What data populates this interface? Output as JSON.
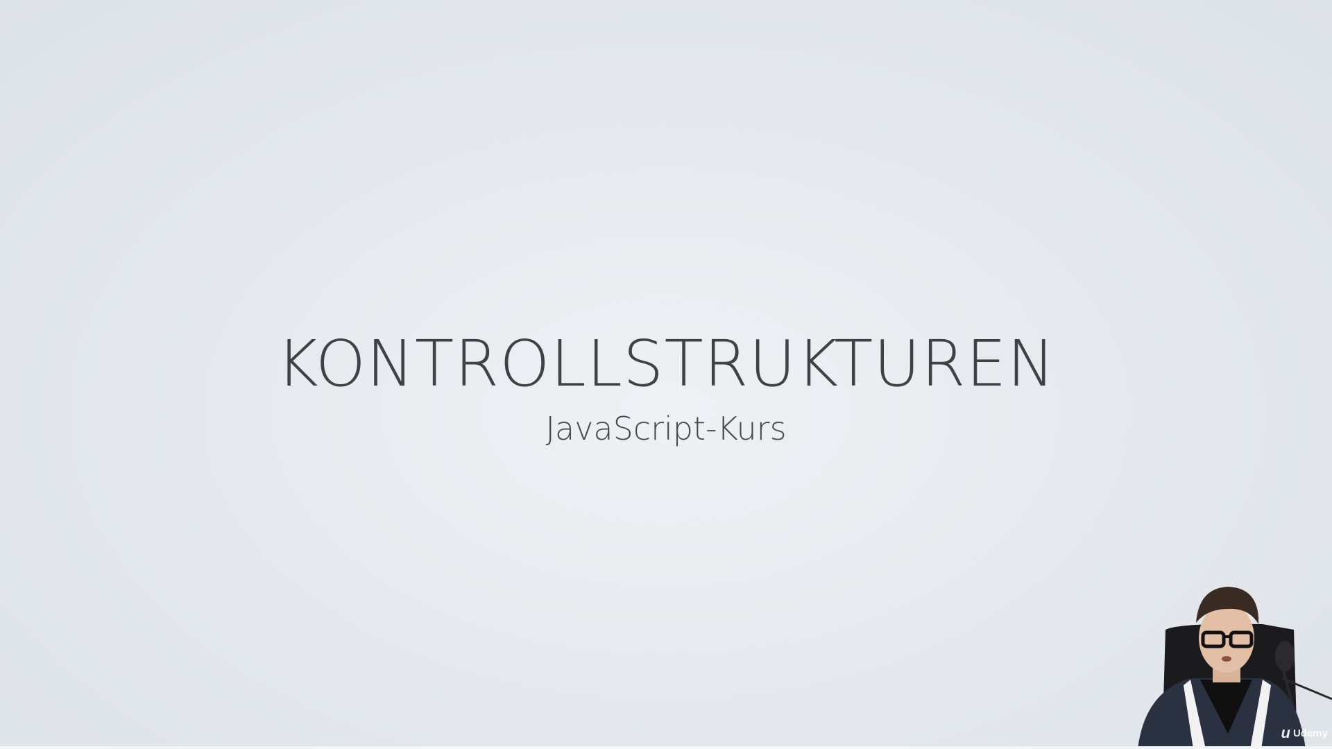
{
  "slide": {
    "title": "KONTROLLSTRUKTUREN",
    "subtitle": "JavaScript-Kurs"
  },
  "webcam": {
    "logo_text": "Udemy"
  },
  "colors": {
    "background": "#e6eaee",
    "text": "#3f4144"
  }
}
